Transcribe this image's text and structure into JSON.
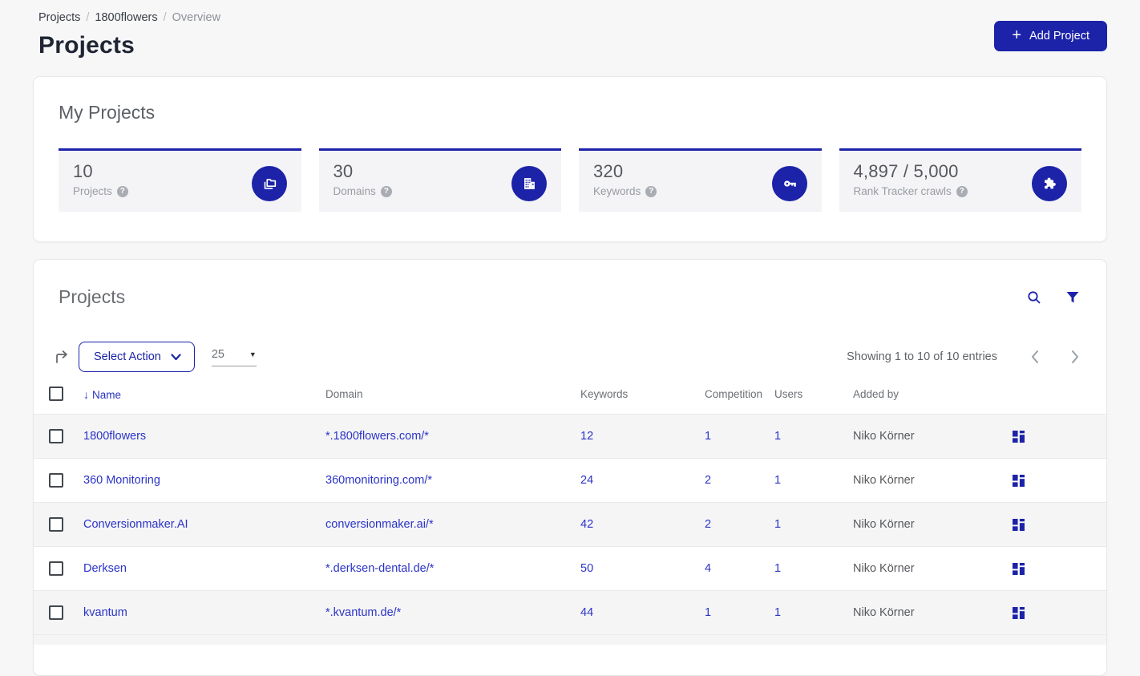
{
  "colors": {
    "brand_blue": "#1c23a8",
    "link_blue": "#2b34c6",
    "page_bg": "#f7f7f8",
    "tile_bg": "#f4f4f6"
  },
  "breadcrumb": {
    "items": [
      "Projects",
      "1800flowers",
      "Overview"
    ],
    "separator": "/"
  },
  "page": {
    "title": "Projects",
    "add_button_label": "Add Project"
  },
  "stats": {
    "title": "My Projects",
    "tiles": [
      {
        "value": "10",
        "label": "Projects",
        "icon": "projects-icon"
      },
      {
        "value": "30",
        "label": "Domains",
        "icon": "domains-icon"
      },
      {
        "value": "320",
        "label": "Keywords",
        "icon": "keywords-icon"
      },
      {
        "value": "4,897 / 5,000",
        "label": "Rank Tracker crawls",
        "icon": "puzzle-icon"
      }
    ]
  },
  "projects_panel": {
    "title": "Projects",
    "toolbar": {
      "select_action_label": "Select Action",
      "page_size": "25",
      "showing_text": "Showing 1 to 10 of 10 entries"
    },
    "table": {
      "columns": [
        "Name",
        "Domain",
        "Keywords",
        "Competition",
        "Users",
        "Added by"
      ],
      "sorted_column": "Name",
      "rows": [
        {
          "name": "1800flowers",
          "domain": "*.1800flowers.com/*",
          "keywords": "12",
          "competition": "1",
          "users": "1",
          "added_by": "Niko Körner"
        },
        {
          "name": "360 Monitoring",
          "domain": "360monitoring.com/*",
          "keywords": "24",
          "competition": "2",
          "users": "1",
          "added_by": "Niko Körner"
        },
        {
          "name": "Conversionmaker.AI",
          "domain": "conversionmaker.ai/*",
          "keywords": "42",
          "competition": "2",
          "users": "1",
          "added_by": "Niko Körner"
        },
        {
          "name": "Derksen",
          "domain": "*.derksen-dental.de/*",
          "keywords": "50",
          "competition": "4",
          "users": "1",
          "added_by": "Niko Körner"
        },
        {
          "name": "kvantum",
          "domain": "*.kvantum.de/*",
          "keywords": "44",
          "competition": "1",
          "users": "1",
          "added_by": "Niko Körner"
        }
      ]
    }
  }
}
